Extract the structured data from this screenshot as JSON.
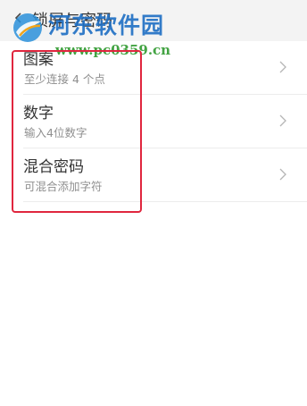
{
  "header": {
    "title": "锁屏与密码"
  },
  "watermark": {
    "name": "河东软件园",
    "url": "www.pc0359.cn"
  },
  "options": [
    {
      "title": "图案",
      "subtitle": "至少连接 4 个点"
    },
    {
      "title": "数字",
      "subtitle": "输入4位数字"
    },
    {
      "title": "混合密码",
      "subtitle": "可混合添加字符"
    }
  ],
  "colors": {
    "highlight": "#e0263e",
    "watermark_blue": "#1e6fc4",
    "watermark_green": "#2f9a2f"
  },
  "icons": {
    "back": "back-icon",
    "row_arrow": "chevron-right-icon",
    "logo": "watermark-logo-icon"
  }
}
